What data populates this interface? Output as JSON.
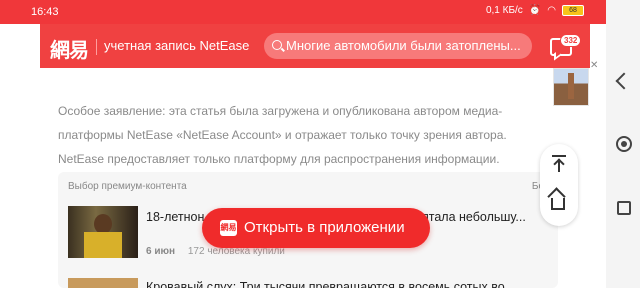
{
  "status_bar": {
    "time": "16:43",
    "speed": "0,1 КБ/с",
    "battery": "68"
  },
  "header": {
    "logo": "網易",
    "account_label": "учетная запись NetEase",
    "search_text": "Многие автомобили были затоплены...",
    "comment_count": "332"
  },
  "article": {
    "disclaimer": "Особое заявление: эта статья была загружена и опубликована автором медиа-платформы NetEase «NetEase Account» и отражает только точку зрения автора. NetEase предоставляет только платформу для распространения информации."
  },
  "premium": {
    "title": "Выбор премиум-контента",
    "more": "Бо",
    "items": [
      {
        "text": "18-летнон                                          ну после того, как она сбежала                                      я спрятала небольшу...",
        "date": "6 июн",
        "buyers": "172 человека купили"
      },
      {
        "text": "Кровавый слух: Три тысячи превращаются в восемь сотых во..."
      }
    ]
  },
  "open_app": {
    "logo": "網易",
    "label": "Открыть в приложении"
  },
  "colors": {
    "brand": "#f04141",
    "button": "#f02b2b"
  },
  "icons": [
    "search-icon",
    "comment-icon",
    "back-to-top-icon",
    "home-icon",
    "close-icon",
    "wifi-icon",
    "alarm-icon"
  ]
}
